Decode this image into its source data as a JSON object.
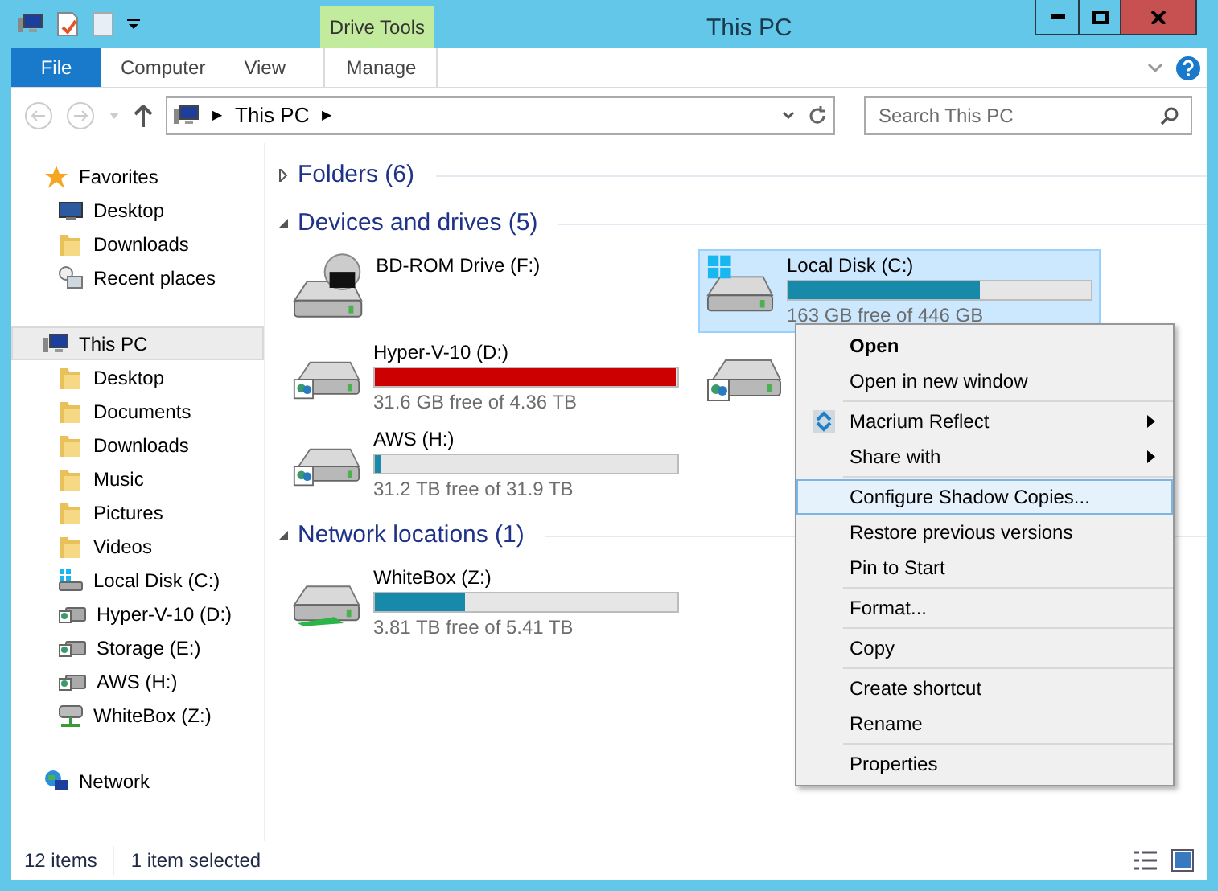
{
  "window": {
    "title": "This PC"
  },
  "ribbon": {
    "context_group": "Drive Tools",
    "tabs": [
      {
        "label": "File",
        "kind": "file"
      },
      {
        "label": "Computer",
        "kind": "plain"
      },
      {
        "label": "View",
        "kind": "plain"
      },
      {
        "label": "Manage",
        "kind": "contextual"
      }
    ]
  },
  "address": {
    "path": [
      "▶",
      "This PC",
      "▶"
    ]
  },
  "search": {
    "placeholder": "Search This PC"
  },
  "sidebar": {
    "groups": [
      {
        "label": "Favorites",
        "kind": "star",
        "selected": false,
        "children": [
          {
            "label": "Desktop",
            "kind": "desktop"
          },
          {
            "label": "Downloads",
            "kind": "folder"
          },
          {
            "label": "Recent places",
            "kind": "recent"
          }
        ]
      },
      {
        "label": "This PC",
        "kind": "pc",
        "selected": true,
        "children": [
          {
            "label": "Desktop",
            "kind": "folder"
          },
          {
            "label": "Documents",
            "kind": "folder"
          },
          {
            "label": "Downloads",
            "kind": "folder"
          },
          {
            "label": "Music",
            "kind": "folder"
          },
          {
            "label": "Pictures",
            "kind": "folder"
          },
          {
            "label": "Videos",
            "kind": "folder"
          },
          {
            "label": "Local Disk (C:)",
            "kind": "system"
          },
          {
            "label": "Hyper-V-10 (D:)",
            "kind": "shared"
          },
          {
            "label": "Storage (E:)",
            "kind": "shared"
          },
          {
            "label": "AWS (H:)",
            "kind": "shared"
          },
          {
            "label": "WhiteBox (Z:)",
            "kind": "network"
          }
        ]
      },
      {
        "label": "Network",
        "kind": "globe",
        "selected": false
      }
    ]
  },
  "sections": [
    {
      "title": "Folders (6)",
      "expanded": false
    },
    {
      "title": "Devices and drives (5)",
      "expanded": true,
      "drives": [
        {
          "name": "BD-ROM Drive (F:)",
          "kind": "optical",
          "selected": false
        },
        {
          "name": "Local Disk (C:)",
          "kind": "system",
          "selected": true,
          "free": "163 GB free of 446 GB",
          "level": 0.635,
          "color": "#168aa8"
        },
        {
          "name": "Hyper-V-10 (D:)",
          "kind": "shared",
          "selected": false,
          "free": "31.6 GB free of 4.36 TB",
          "level": 0.993,
          "color": "#cc0000"
        },
        {
          "kind": "shared",
          "selected": false
        },
        {
          "name": "AWS (H:)",
          "kind": "shared",
          "selected": false,
          "free": "31.2 TB free of 31.9 TB",
          "level": 0.022,
          "color": "#168aa8"
        }
      ]
    },
    {
      "title": "Network locations (1)",
      "expanded": true,
      "drives": [
        {
          "name": "WhiteBox (Z:)",
          "kind": "network",
          "selected": false,
          "free": "3.81 TB free of 5.41 TB",
          "level": 0.296,
          "color": "#168aa8"
        }
      ]
    }
  ],
  "context_menu": {
    "groups": [
      [
        {
          "label": "Open",
          "bold": true,
          "submenu": false,
          "selected": false
        },
        {
          "label": "Open in new window",
          "bold": false,
          "submenu": false,
          "selected": false
        }
      ],
      [
        {
          "label": "Macrium Reflect",
          "bold": false,
          "submenu": true,
          "selected": false,
          "kind": "app"
        },
        {
          "label": "Share with",
          "bold": false,
          "submenu": true,
          "selected": false
        }
      ],
      [
        {
          "label": "Configure Shadow Copies...",
          "bold": false,
          "submenu": false,
          "selected": true
        },
        {
          "label": "Restore previous versions",
          "bold": false,
          "submenu": false,
          "selected": false
        },
        {
          "label": "Pin to Start",
          "bold": false,
          "submenu": false,
          "selected": false
        }
      ],
      [
        {
          "label": "Format...",
          "bold": false,
          "submenu": false,
          "selected": false
        }
      ],
      [
        {
          "label": "Copy",
          "bold": false,
          "submenu": false,
          "selected": false
        }
      ],
      [
        {
          "label": "Create shortcut",
          "bold": false,
          "submenu": false,
          "selected": false
        },
        {
          "label": "Rename",
          "bold": false,
          "submenu": false,
          "selected": false
        }
      ],
      [
        {
          "label": "Properties",
          "bold": false,
          "submenu": false,
          "selected": false
        }
      ]
    ]
  },
  "status_bar": {
    "count": "12 items",
    "selection": "1 item selected"
  }
}
